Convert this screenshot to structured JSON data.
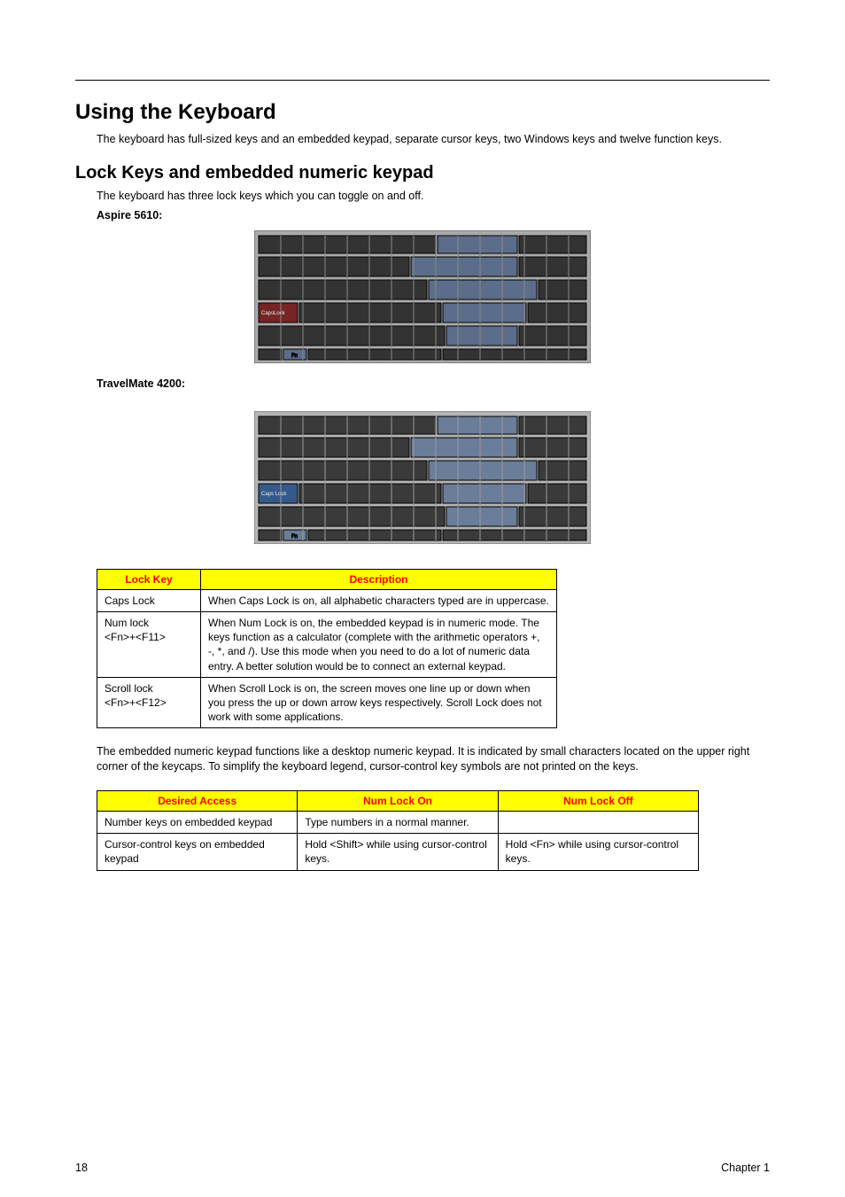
{
  "section_title": "Using the Keyboard",
  "intro_paragraph": "The keyboard has full-sized keys and an embedded keypad, separate cursor keys, two Windows keys and twelve function keys.",
  "subsection_title": "Lock Keys and embedded numeric keypad",
  "subsection_intro": "The keyboard has three lock keys which you can toggle on and off.",
  "model_label_1": "Aspire 5610:",
  "model_label_2": "TravelMate 4200:",
  "lock_table": {
    "headers": [
      "Lock Key",
      "Description"
    ],
    "rows": [
      {
        "key": "Caps Lock",
        "desc": "When Caps Lock is on, all alphabetic characters typed are in uppercase."
      },
      {
        "key": "Num lock\n<Fn>+<F11>",
        "desc": "When Num Lock is on, the embedded keypad is in numeric mode. The keys function as a calculator (complete with the arithmetic operators +, -, *, and /). Use this mode when you need to do a lot of numeric data entry. A better solution would be to connect an external keypad."
      },
      {
        "key": "Scroll lock\n<Fn>+<F12>",
        "desc": "When Scroll Lock is on, the screen moves one line up or down when you press the up or down arrow keys respectively. Scroll Lock does not work with some applications."
      }
    ]
  },
  "embedded_paragraph": "The embedded numeric keypad functions like a desktop numeric keypad. It is indicated by small characters located on the upper right corner of the keycaps. To simplify the keyboard legend, cursor-control key symbols are not printed on the keys.",
  "access_table": {
    "headers": [
      "Desired Access",
      "Num Lock On",
      "Num Lock Off"
    ],
    "rows": [
      {
        "c1": "Number keys on embedded keypad",
        "c2": "Type numbers in a normal manner.",
        "c3": ""
      },
      {
        "c1": "Cursor-control keys on embedded keypad",
        "c2": "Hold <Shift> while using cursor-control keys.",
        "c3": "Hold <Fn> while using cursor-control keys."
      }
    ]
  },
  "footer": {
    "page_number": "18",
    "chapter_label": "Chapter 1"
  }
}
